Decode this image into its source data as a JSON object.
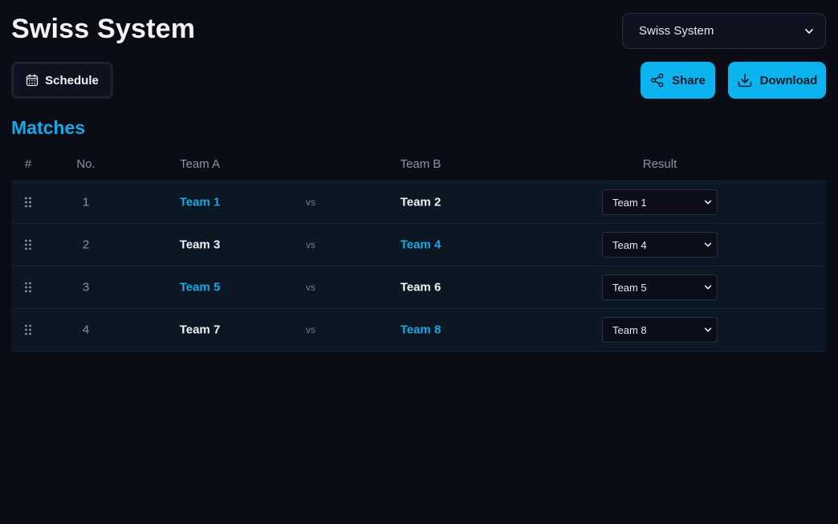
{
  "header": {
    "title": "Swiss System",
    "format_select": {
      "value": "Swiss System"
    }
  },
  "toolbar": {
    "schedule_label": "Schedule",
    "share_label": "Share",
    "download_label": "Download"
  },
  "colors": {
    "background": "#0b0d16",
    "accent": "#0bb4ef",
    "winner_text": "#14a9e2",
    "row_bg": "#0c1724"
  },
  "section": {
    "title": "Matches"
  },
  "table": {
    "headers": {
      "hash": "#",
      "no": "No.",
      "team_a": "Team A",
      "team_b": "Team B",
      "result": "Result"
    },
    "rows": [
      {
        "no": "1",
        "team_a": "Team 1",
        "vs": "vs",
        "team_b": "Team 2",
        "result": "Team 1",
        "winner": "a"
      },
      {
        "no": "2",
        "team_a": "Team 3",
        "vs": "vs",
        "team_b": "Team 4",
        "result": "Team 4",
        "winner": "b"
      },
      {
        "no": "3",
        "team_a": "Team 5",
        "vs": "vs",
        "team_b": "Team 6",
        "result": "Team 5",
        "winner": "a"
      },
      {
        "no": "4",
        "team_a": "Team 7",
        "vs": "vs",
        "team_b": "Team 8",
        "result": "Team 8",
        "winner": "b"
      }
    ]
  },
  "icons": {
    "schedule": "calendar-icon",
    "share": "share-icon",
    "download": "download-icon",
    "drag": "drag-handle-icon",
    "dropdown": "chevron-down-icon"
  }
}
